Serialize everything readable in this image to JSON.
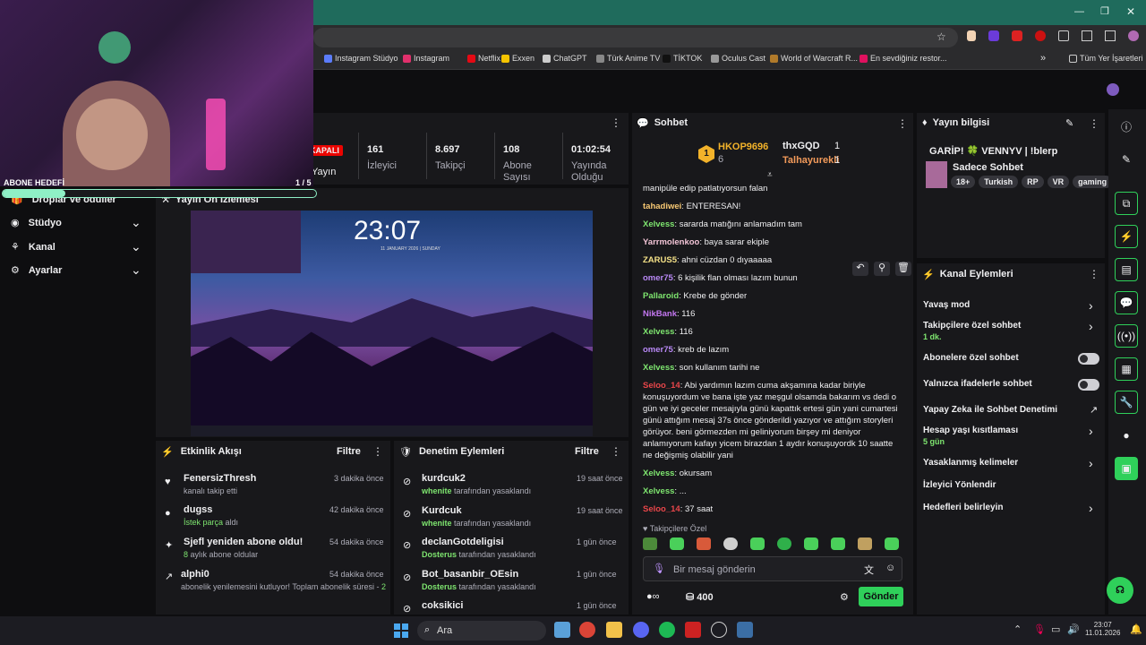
{
  "bookmarks": [
    {
      "label": "Instagram Stüdyo",
      "color": "#5b7cfa"
    },
    {
      "label": "Instagram",
      "color": "#e1306c"
    },
    {
      "label": "Netflix",
      "color": "#e50914"
    },
    {
      "label": "Exxen",
      "color": "#f5c400"
    },
    {
      "label": "ChatGPT",
      "color": "#cccccc"
    },
    {
      "label": "Türk Anime TV",
      "color": "#888888"
    },
    {
      "label": "TİKTOK",
      "color": "#111111"
    },
    {
      "label": "Oculus Cast",
      "color": "#999999"
    },
    {
      "label": "World of Warcraft R...",
      "color": "#b07a2a"
    },
    {
      "label": "En sevdiğiniz restor...",
      "color": "#e0115f"
    }
  ],
  "all_bookmarks": "Tüm Yer İşaretleri",
  "overlay": {
    "goal_label": "ABONE HEDEFİ",
    "goal_count": "1 / 5"
  },
  "left_nav": [
    {
      "label": "Droplar ve ödüller"
    },
    {
      "label": "Stüdyo"
    },
    {
      "label": "Kanal"
    },
    {
      "label": "Ayarlar"
    }
  ],
  "stats": {
    "live_badge": "KAPALI",
    "items": [
      {
        "value": "",
        "label": "Yayın"
      },
      {
        "value": "161",
        "label": "İzleyici"
      },
      {
        "value": "8.697",
        "label": "Takipçi"
      },
      {
        "value": "108",
        "label": "Abone Sayısı"
      },
      {
        "value": "01:02:54",
        "label": "Yayında Olduğu"
      }
    ]
  },
  "preview": {
    "title": "Yayın Ön İzlemesi",
    "time": "23:07",
    "date": "11 JANUARY 2026 | SUNDAY"
  },
  "activity": {
    "title": "Etkinlik Akışı",
    "filter": "Filtre",
    "items": [
      {
        "name": "FenersizThresh",
        "time": "3 dakika önce",
        "sub": "kanalı takip etti",
        "hl": ""
      },
      {
        "name": "dugss",
        "time": "42 dakika önce",
        "sub": "aldı",
        "hl": "İstek parça"
      },
      {
        "name": "Sjefl yeniden abone oldu!",
        "time": "54 dakika önce",
        "sub": "aylık abone oldular",
        "hl": "8"
      },
      {
        "name": "alphi0",
        "time": "54 dakika önce",
        "sub": "abonelik yenilemesini kutluyor! Toplam abonelik süresi - ",
        "hl": "2"
      }
    ]
  },
  "moderation": {
    "title": "Denetim Eylemleri",
    "filter": "Filtre",
    "items": [
      {
        "name": "kurdcuk2",
        "time": "19 saat önce",
        "by": "whenite",
        "action": "tarafından yasaklandı"
      },
      {
        "name": "Kurdcuk",
        "time": "19 saat önce",
        "by": "whenite",
        "action": "tarafından yasaklandı"
      },
      {
        "name": "declanGotdeligisi",
        "time": "1 gün önce",
        "by": "Dosterus",
        "action": "tarafından yasaklandı"
      },
      {
        "name": "Bot_basanbir_OEsin",
        "time": "1 gün önce",
        "by": "Dosterus",
        "action": "tarafından yasaklandı"
      },
      {
        "name": "coksikici",
        "time": "1 gün önce",
        "by": "",
        "action": ""
      }
    ]
  },
  "chat": {
    "title": "Sohbet",
    "leaders": {
      "first": "HKOP9696",
      "first_count": "6",
      "second": "thxGQD",
      "second_count": "1",
      "third": "Talhayurekli",
      "third_count": "1"
    },
    "messages": [
      {
        "user": "",
        "color": "#efeff1",
        "text": "manipüle edip patlatıyorsun falan"
      },
      {
        "user": "tahadiwei",
        "color": "#f7c873",
        "text": "ENTERESAN!"
      },
      {
        "user": "Xelvess",
        "color": "#7ee56f",
        "text": "sararda matığını anlamadım tam"
      },
      {
        "user": "Yarrmolenkoo",
        "color": "#f2c4d6",
        "text": "baya sarar ekiple"
      },
      {
        "user": "ZARUS5",
        "color": "#f4e087",
        "text": "ahni cüzdan 0 dıyaaaaa"
      },
      {
        "user": "omer75",
        "color": "#b888f5",
        "text": "6 kişilik flan olması lazım bunun"
      },
      {
        "user": "Pallaroid",
        "color": "#7ee56f",
        "text": "Krebe de gönder"
      },
      {
        "user": "NikBank",
        "color": "#c377f0",
        "text": "116"
      },
      {
        "user": "Xelvess",
        "color": "#7ee56f",
        "text": "116"
      },
      {
        "user": "omer75",
        "color": "#b888f5",
        "text": "kreb de lazım"
      },
      {
        "user": "Xelvess",
        "color": "#7ee56f",
        "text": "son kullanım tarihi ne"
      },
      {
        "user": "Seloo_14",
        "color": "#e8464a",
        "text": "Abi yardımın lazım cuma akşamına kadar biriyle konuşuyordum ve bana işte yaz meşgul olsamda bakarım vs dedi o gün ve iyi geceler mesajıyla günü kapattık ertesi gün yani cumartesi günü attığım mesaj 37s önce gönderildi yazıyor ve attığım storyleri görüyor. beni görmezden mi geliniyorum birşey mi deniyor anlamıyorum kafayı yicem birazdan 1 aydır konuşuyordk 10 saatte ne değişmiş olabilir yani"
      },
      {
        "user": "Xelvess",
        "color": "#7ee56f",
        "text": "okursam"
      },
      {
        "user": "Xelvess",
        "color": "#7ee56f",
        "text": "..."
      },
      {
        "user": "Seloo_14",
        "color": "#e8464a",
        "text": "37 saat"
      }
    ],
    "followers_only": "Takipçilere Özel",
    "placeholder": "Bir mesaj gönderin",
    "points": "400",
    "send": "Gönder"
  },
  "stream_info": {
    "title": "Yayın bilgisi",
    "stream_title": "GARİP! 🍀 VENNYV | !blerp",
    "category": "Sadece Sohbet",
    "tags": [
      "18+",
      "Turkish",
      "RP",
      "VR",
      "gaming"
    ]
  },
  "channel_actions": {
    "title": "Kanal Eylemleri",
    "items": [
      {
        "label": "Yavaş mod",
        "sub": "",
        "kind": "chev"
      },
      {
        "label": "Takipçilere özel sohbet",
        "sub": "1 dk.",
        "kind": "chev"
      },
      {
        "label": "Abonelere özel sohbet",
        "sub": "",
        "kind": "toggle"
      },
      {
        "label": "Yalnızca ifadelerle sohbet",
        "sub": "",
        "kind": "toggle"
      },
      {
        "label": "Yapay Zeka ile Sohbet Denetimi",
        "sub": "",
        "kind": "ext"
      },
      {
        "label": "Hesap yaşı kısıtlaması",
        "sub": "5 gün",
        "kind": "chev"
      },
      {
        "label": "Yasaklanmış kelimeler",
        "sub": "",
        "kind": "chev"
      },
      {
        "label": "İzleyici Yönlendir",
        "sub": "",
        "kind": "none"
      },
      {
        "label": "Hedefleri belirleyin",
        "sub": "",
        "kind": "chev"
      }
    ]
  },
  "taskbar": {
    "search": "Ara",
    "time": "23:07",
    "date": "11.01.2026"
  }
}
